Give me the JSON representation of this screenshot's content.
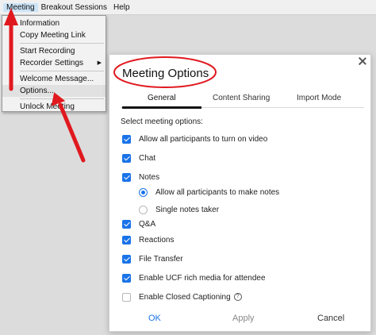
{
  "menubar": {
    "items": [
      "Meeting",
      "Breakout Sessions",
      "Help"
    ],
    "underline_mnemonics": [
      "M",
      "B",
      "H"
    ]
  },
  "dropdown": {
    "items": [
      {
        "label": "Information"
      },
      {
        "label": "Copy Meeting Link"
      },
      {
        "label": "Start Recording"
      },
      {
        "label": "Recorder Settings"
      },
      {
        "label": "Welcome Message..."
      },
      {
        "label": "Options..."
      },
      {
        "label": "Unlock Meeting"
      }
    ]
  },
  "dialog": {
    "title": "Meeting Options",
    "tabs": [
      "General",
      "Content Sharing",
      "Import Mode"
    ],
    "section_label": "Select meeting options:",
    "options": [
      {
        "label": "Allow all participants to turn on video",
        "checked": true
      },
      {
        "label": "Chat",
        "checked": true
      },
      {
        "label": "Notes",
        "checked": true
      },
      {
        "label": "Allow all participants to make notes",
        "selected": true
      },
      {
        "label": "Single notes taker",
        "selected": false
      },
      {
        "label": "Q&A",
        "checked": true
      },
      {
        "label": "Reactions",
        "checked": true
      },
      {
        "label": "File Transfer",
        "checked": true
      },
      {
        "label": "Enable UCF rich media for attendee",
        "checked": true
      },
      {
        "label": "Enable Closed Captioning",
        "checked": false
      }
    ],
    "buttons": {
      "ok": "OK",
      "apply": "Apply",
      "cancel": "Cancel"
    }
  },
  "colors": {
    "accent": "#1a73e8",
    "annotation": "#e0191f"
  }
}
